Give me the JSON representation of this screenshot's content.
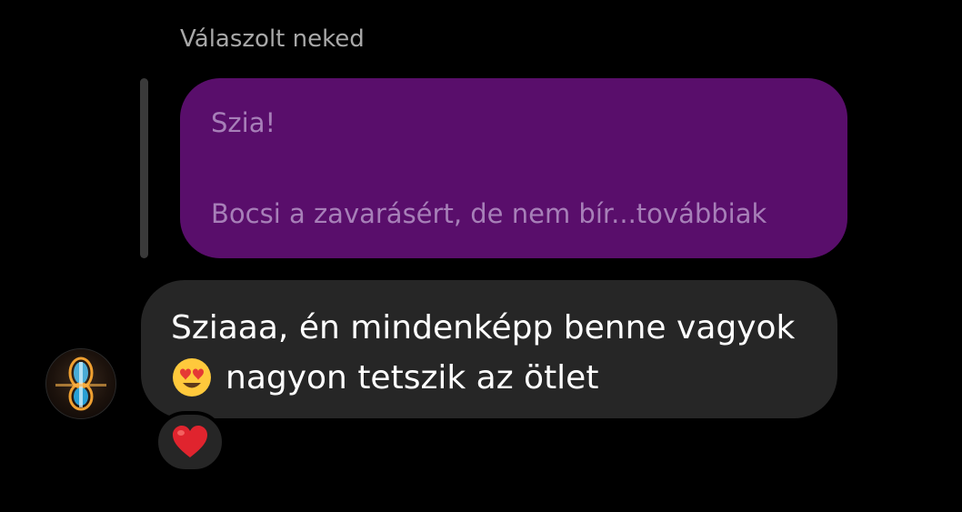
{
  "reply_header": {
    "label": "Válaszolt neked"
  },
  "quoted_message": {
    "line1": "Szia!",
    "line2": "Bocsi a zavarásért, de nem bír...továbbiak",
    "background_color": "#590e6b",
    "text_color": "#a77fb8"
  },
  "message": {
    "line1": "Sziaaa, én mindenképp benne vagyok",
    "line2_emoji": "smiling-face-with-heart-eyes-icon",
    "line2_text": "nagyon tetszik az ötlet",
    "background_color": "#262626"
  },
  "avatar": {
    "icon": "avatar-portal-image"
  },
  "reaction": {
    "icon": "red-heart-icon",
    "color": "#e0242e"
  }
}
